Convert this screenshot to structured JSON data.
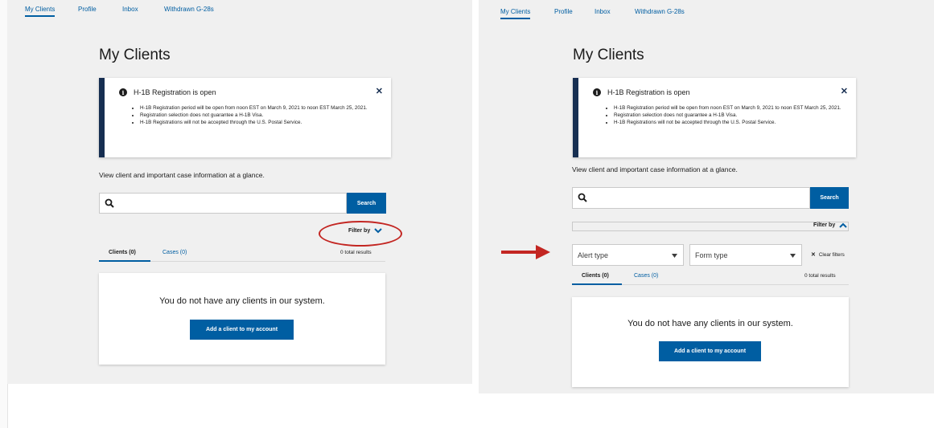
{
  "nav": {
    "items": [
      "My Clients",
      "Profile",
      "Inbox",
      "Withdrawn G-28s"
    ]
  },
  "page": {
    "title": "My Clients",
    "intro": "View client and important case information at a glance."
  },
  "alert": {
    "title": "H-1B Registration is open",
    "close_icon": "close-icon",
    "bullets": [
      "H-1B Registration period will be open from noon EST on March 9, 2021 to noon EST March 25, 2021.",
      "Registration selection does not guarantee a H-1B Visa.",
      "H-1B Registrations will not be accepted through the U.S. Postal Service."
    ]
  },
  "search": {
    "placeholder": "",
    "value": "",
    "button_label": "Search"
  },
  "filter": {
    "toggle_label": "Filter by",
    "alert_type_label": "Alert type",
    "form_type_label": "Form type",
    "clear_label": "Clear filters"
  },
  "tabs": {
    "clients": "Clients (0)",
    "cases": "Cases (0)",
    "total_results": "0 total results"
  },
  "empty_state": {
    "message": "You do not have any clients in our system.",
    "button_label": "Add a client to my account"
  },
  "annotation": {
    "highlight_color": "#c32622"
  },
  "colors": {
    "primary": "#005ea2",
    "alert_border": "#162e51",
    "background": "#f0f0f0"
  }
}
